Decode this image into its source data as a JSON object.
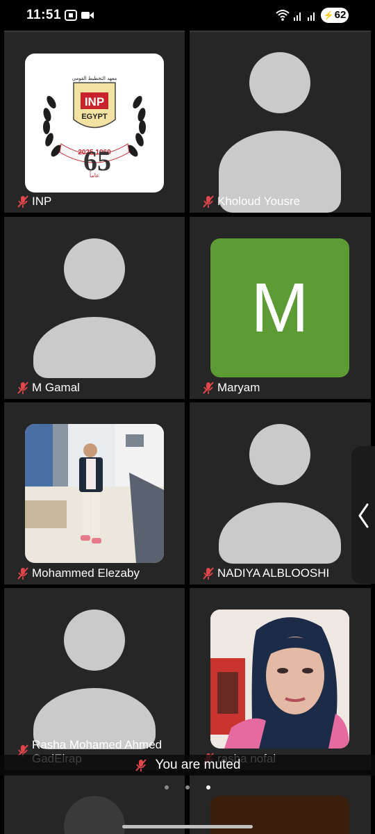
{
  "status": {
    "time": "11:51",
    "battery": "62"
  },
  "participants": [
    {
      "name": "INP",
      "avatar": "logo"
    },
    {
      "name": "Kholoud Yousre",
      "avatar": "placeholder"
    },
    {
      "name": "M Gamal",
      "avatar": "placeholder"
    },
    {
      "name": "Maryam",
      "avatar": "letter",
      "letter": "M",
      "color": "#5d9b35"
    },
    {
      "name": "Mohammed Elezaby",
      "avatar": "photo"
    },
    {
      "name": "NADIYA ALBLOOSHI",
      "avatar": "placeholder"
    },
    {
      "name": "Rasha Mohamed Ahmed\nGadElrap",
      "avatar": "placeholder"
    },
    {
      "name": "rasha nofal",
      "avatar": "photo"
    }
  ],
  "logo": {
    "top_text": "معهد التخطيط القومي",
    "badge": "INP",
    "country": "EGYPT",
    "years": "2025  1960",
    "anniversary": "65",
    "anniversary_word": "عاماً"
  },
  "banner": {
    "text": "You are muted"
  },
  "pagination": {
    "pages": 3,
    "active": 3
  },
  "colors": {
    "tile_bg": "#262626",
    "placeholder": "#cacaca",
    "mic_muted": "#e0464a"
  }
}
